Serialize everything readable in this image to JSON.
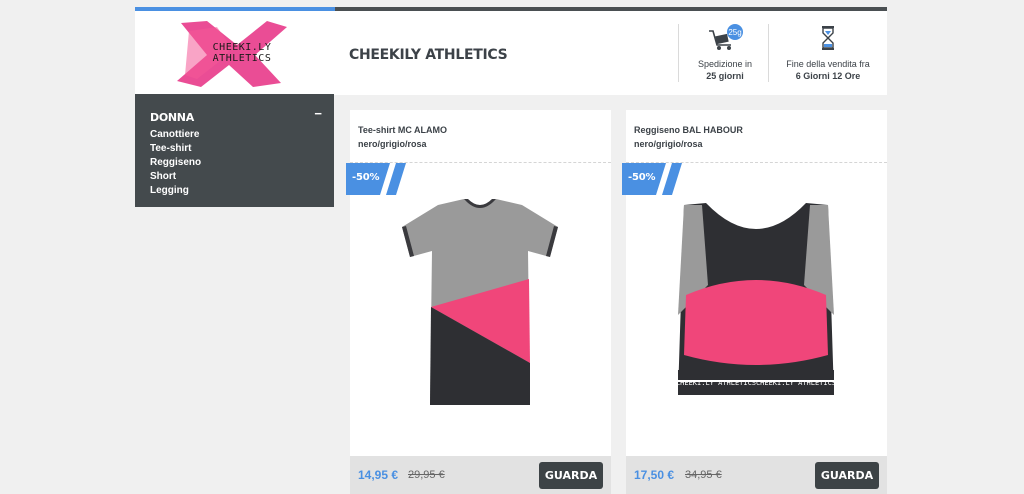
{
  "brand": {
    "logo_text_line1": "CHEEKI.LY",
    "logo_text_line2": "ATHLETICS",
    "logo_color": "#e83e8c"
  },
  "header": {
    "store_title": "CHEEKILY ATHLETICS",
    "shipping": {
      "icon": "delivery-truck-icon",
      "badge": "25g",
      "label": "Spedizione in",
      "value": "25 giorni"
    },
    "deadline": {
      "icon": "hourglass-icon",
      "label": "Fine della vendita fra",
      "value": "6 Giorni 12 Ore"
    }
  },
  "sidebar": {
    "title": "DONNA",
    "collapse_icon": "−",
    "items": [
      {
        "label": "Canottiere"
      },
      {
        "label": "Tee-shirt"
      },
      {
        "label": "Reggiseno"
      },
      {
        "label": "Short"
      },
      {
        "label": "Legging"
      }
    ]
  },
  "products": [
    {
      "name": "Tee-shirt MC ALAMO",
      "color": "nero/grigio/rosa",
      "discount": "-50%",
      "price": "14,95 €",
      "old_price": "29,95 €",
      "button": "GUARDA",
      "image": "t-shirt"
    },
    {
      "name": "Reggiseno BAL HABOUR",
      "color": "nero/grigio/rosa",
      "discount": "-50%",
      "price": "17,50 €",
      "old_price": "34,95 €",
      "button": "GUARDA",
      "image": "sports-bra",
      "print_text": "CHEEKI.LY ATHLETICS"
    }
  ],
  "colors": {
    "accent_blue": "#4a90e2",
    "dark": "#444a4d",
    "pink": "#f0467a",
    "grey_fabric": "#9a9a9a"
  }
}
